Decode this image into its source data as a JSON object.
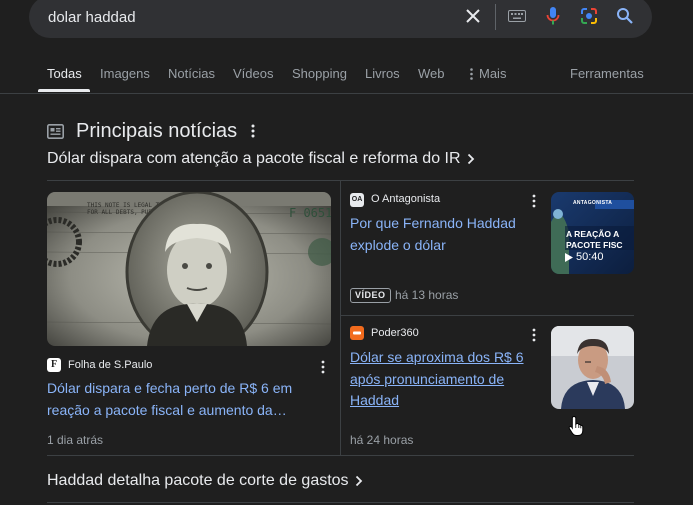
{
  "search": {
    "query": "dolar haddad"
  },
  "tabs": [
    {
      "label": "Todas",
      "active": true
    },
    {
      "label": "Imagens"
    },
    {
      "label": "Notícias"
    },
    {
      "label": "Vídeos"
    },
    {
      "label": "Shopping"
    },
    {
      "label": "Livros"
    },
    {
      "label": "Web"
    },
    {
      "label": "Mais"
    }
  ],
  "tools_label": "Ferramentas",
  "section": {
    "title": "Principais notícias",
    "subtitle": "Dólar dispara com atenção a pacote fiscal e reforma do IR"
  },
  "main_article": {
    "source": "Folha de S.Paulo",
    "logo_letter": "F",
    "headline_line1": "Dólar dispara e fecha perto de R$ 6 em",
    "headline_line2": "reação a pacote fiscal e aumento da…",
    "time": "1 dia atrás"
  },
  "article2": {
    "source": "O Antagonista",
    "logo_text": "OA",
    "headline_line1": "Por que Fernando Haddad",
    "headline_line2": "explode o dólar",
    "badge": "VÍDEO",
    "time": "há 13 horas",
    "duration": "50:40",
    "thumb_text1": "A REAÇÃO A",
    "thumb_text2": "PACOTE FISC",
    "thumb_tag": "ANTAGONISTA"
  },
  "article3": {
    "source": "Poder360",
    "headline_line1": "Dólar se aproxima dos R$ 6",
    "headline_line2": "após pronunciamento de",
    "headline_line3": "Haddad",
    "time": "há 24 horas"
  },
  "next_section": {
    "title": "Haddad detalha pacote de corte de gastos"
  },
  "colors": {
    "background": "#1f1f1f",
    "search_bg": "#303134",
    "link": "#8ab4f8",
    "muted": "#9aa0a6"
  }
}
